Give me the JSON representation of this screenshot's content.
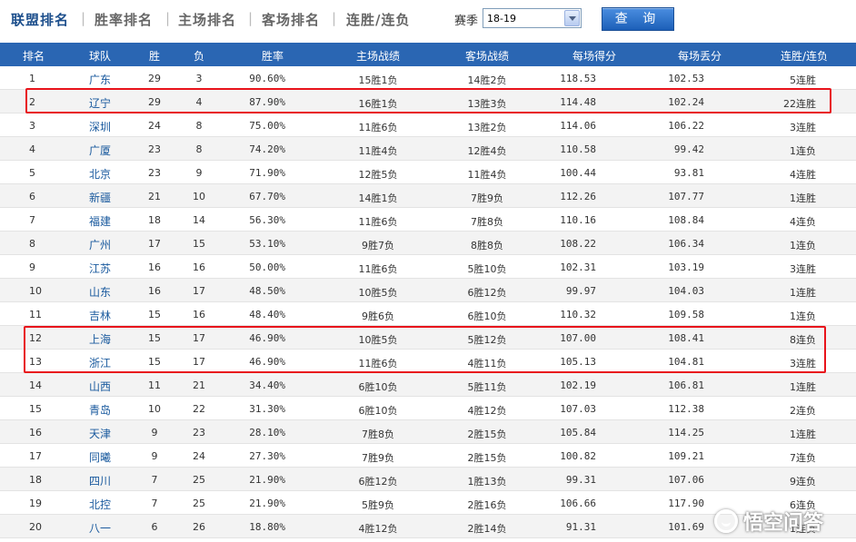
{
  "tabs": [
    {
      "label": "联盟排名",
      "active": true
    },
    {
      "label": "胜率排名",
      "active": false
    },
    {
      "label": "主场排名",
      "active": false
    },
    {
      "label": "客场排名",
      "active": false
    },
    {
      "label": "连胜/连负",
      "active": false
    }
  ],
  "season": {
    "label": "赛季",
    "value": "18-19"
  },
  "query_button": "查 询",
  "columns": [
    "排名",
    "球队",
    "胜",
    "负",
    "胜率",
    "主场战绩",
    "客场战绩",
    "每场得分",
    "每场丢分",
    "连胜/连负"
  ],
  "rows": [
    [
      "1",
      "广东",
      "29",
      "3",
      "90.60%",
      "15胜1负",
      "14胜2负",
      "118.53",
      "102.53",
      "5连胜"
    ],
    [
      "2",
      "辽宁",
      "29",
      "4",
      "87.90%",
      "16胜1负",
      "13胜3负",
      "114.48",
      "102.24",
      "22连胜"
    ],
    [
      "3",
      "深圳",
      "24",
      "8",
      "75.00%",
      "11胜6负",
      "13胜2负",
      "114.06",
      "106.22",
      "3连胜"
    ],
    [
      "4",
      "广厦",
      "23",
      "8",
      "74.20%",
      "11胜4负",
      "12胜4负",
      "110.58",
      "99.42",
      "1连负"
    ],
    [
      "5",
      "北京",
      "23",
      "9",
      "71.90%",
      "12胜5负",
      "11胜4负",
      "100.44",
      "93.81",
      "4连胜"
    ],
    [
      "6",
      "新疆",
      "21",
      "10",
      "67.70%",
      "14胜1负",
      "7胜9负",
      "112.26",
      "107.77",
      "1连胜"
    ],
    [
      "7",
      "福建",
      "18",
      "14",
      "56.30%",
      "11胜6负",
      "7胜8负",
      "110.16",
      "108.84",
      "4连负"
    ],
    [
      "8",
      "广州",
      "17",
      "15",
      "53.10%",
      "9胜7负",
      "8胜8负",
      "108.22",
      "106.34",
      "1连负"
    ],
    [
      "9",
      "江苏",
      "16",
      "16",
      "50.00%",
      "11胜6负",
      "5胜10负",
      "102.31",
      "103.19",
      "3连胜"
    ],
    [
      "10",
      "山东",
      "16",
      "17",
      "48.50%",
      "10胜5负",
      "6胜12负",
      "99.97",
      "104.03",
      "1连胜"
    ],
    [
      "11",
      "吉林",
      "15",
      "16",
      "48.40%",
      "9胜6负",
      "6胜10负",
      "110.32",
      "109.58",
      "1连负"
    ],
    [
      "12",
      "上海",
      "15",
      "17",
      "46.90%",
      "10胜5负",
      "5胜12负",
      "107.00",
      "108.41",
      "8连负"
    ],
    [
      "13",
      "浙江",
      "15",
      "17",
      "46.90%",
      "11胜6负",
      "4胜11负",
      "105.13",
      "104.81",
      "3连胜"
    ],
    [
      "14",
      "山西",
      "11",
      "21",
      "34.40%",
      "6胜10负",
      "5胜11负",
      "102.19",
      "106.81",
      "1连胜"
    ],
    [
      "15",
      "青岛",
      "10",
      "22",
      "31.30%",
      "6胜10负",
      "4胜12负",
      "107.03",
      "112.38",
      "2连负"
    ],
    [
      "16",
      "天津",
      "9",
      "23",
      "28.10%",
      "7胜8负",
      "2胜15负",
      "105.84",
      "114.25",
      "1连胜"
    ],
    [
      "17",
      "同曦",
      "9",
      "24",
      "27.30%",
      "7胜9负",
      "2胜15负",
      "100.82",
      "109.21",
      "7连负"
    ],
    [
      "18",
      "四川",
      "7",
      "25",
      "21.90%",
      "6胜12负",
      "1胜13负",
      "99.31",
      "107.06",
      "9连负"
    ],
    [
      "19",
      "北控",
      "7",
      "25",
      "21.90%",
      "5胜9负",
      "2胜16负",
      "106.66",
      "117.90",
      "6连负"
    ],
    [
      "20",
      "八一",
      "6",
      "26",
      "18.80%",
      "4胜12负",
      "2胜14负",
      "91.31",
      "101.69",
      "1连负"
    ]
  ],
  "watermark": "悟空问答",
  "colors": {
    "header_bg": "#2a66b3",
    "team_link": "#1a5a9e",
    "highlight": "#e8131b",
    "active_tab": "#1d4f8c"
  }
}
